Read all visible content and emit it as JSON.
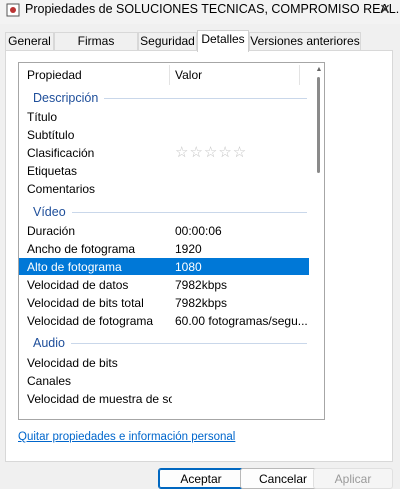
{
  "window": {
    "title": "Propiedades de SOLUCIONES TECNICAS, COMPROMISO REAL...",
    "close_icon": "×"
  },
  "tabs": [
    {
      "label": "General",
      "active": false
    },
    {
      "label": "Firmas digitales",
      "active": false
    },
    {
      "label": "Seguridad",
      "active": false
    },
    {
      "label": "Detalles",
      "active": true
    },
    {
      "label": "Versiones anteriores",
      "active": false
    }
  ],
  "table": {
    "headers": {
      "property": "Propiedad",
      "value": "Valor"
    },
    "groups": {
      "description": "Descripción",
      "video": "Vídeo",
      "audio": "Audio"
    },
    "description_rows": [
      {
        "key": "Título",
        "value": ""
      },
      {
        "key": "Subtítulo",
        "value": ""
      },
      {
        "key": "Clasificación",
        "value": "",
        "stars": "☆☆☆☆☆"
      },
      {
        "key": "Etiquetas",
        "value": ""
      },
      {
        "key": "Comentarios",
        "value": ""
      }
    ],
    "video_rows": [
      {
        "key": "Duración",
        "value": "00:00:06"
      },
      {
        "key": "Ancho de fotograma",
        "value": "1920"
      },
      {
        "key": "Alto de fotograma",
        "value": "1080",
        "selected": true
      },
      {
        "key": "Velocidad de datos",
        "value": "7982kbps"
      },
      {
        "key": "Velocidad de bits total",
        "value": "7982kbps"
      },
      {
        "key": "Velocidad de fotograma",
        "value": "60.00 fotogramas/segu..."
      }
    ],
    "audio_rows": [
      {
        "key": "Velocidad de bits",
        "value": ""
      },
      {
        "key": "Canales",
        "value": ""
      },
      {
        "key": "Velocidad de muestra de so...",
        "value": ""
      }
    ]
  },
  "link": {
    "label": "Quitar propiedades e información personal"
  },
  "buttons": {
    "accept": "Aceptar",
    "cancel": "Cancelar",
    "apply": "Aplicar"
  },
  "colors": {
    "selection": "#0078d7",
    "group_label": "#1e4e9a",
    "link": "#0066cc"
  }
}
